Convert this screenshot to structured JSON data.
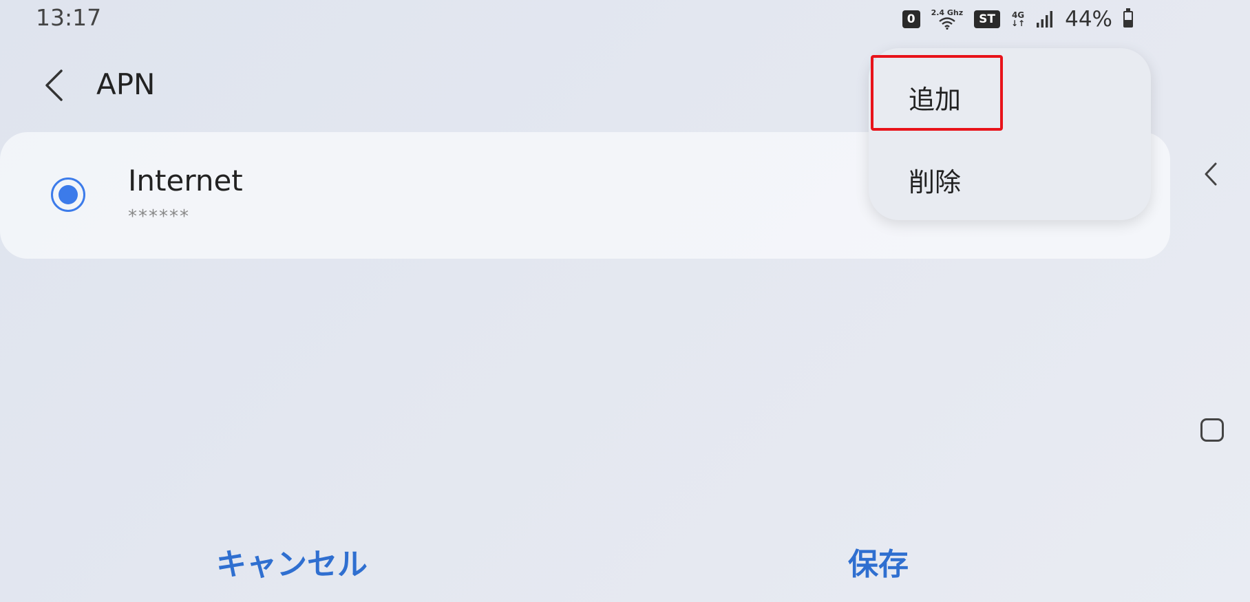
{
  "status_bar": {
    "time": "13:17",
    "badge_zero": "0",
    "wifi_label": "2.4 Ghz",
    "badge_st": "ST",
    "network_type": "4G",
    "network_arrows": "↓↑",
    "battery_percent": "44%",
    "battery_level": 0.44
  },
  "header": {
    "title": "APN"
  },
  "apn_list": [
    {
      "name": "Internet",
      "subtitle": "******",
      "selected": true
    }
  ],
  "popup_menu": {
    "items": [
      {
        "label": "追加",
        "highlighted": true
      },
      {
        "label": "削除",
        "highlighted": false
      }
    ]
  },
  "footer": {
    "cancel_label": "キャンセル",
    "save_label": "保存"
  },
  "colors": {
    "accent": "#3c7bea",
    "button_text": "#2f6fd0",
    "highlight": "#e8131a"
  },
  "icons": {
    "back": "chevron-left-icon",
    "edge_back": "chevron-left-icon",
    "home": "square-icon",
    "wifi": "wifi-icon",
    "signal": "signal-bars-icon",
    "battery": "battery-icon"
  }
}
